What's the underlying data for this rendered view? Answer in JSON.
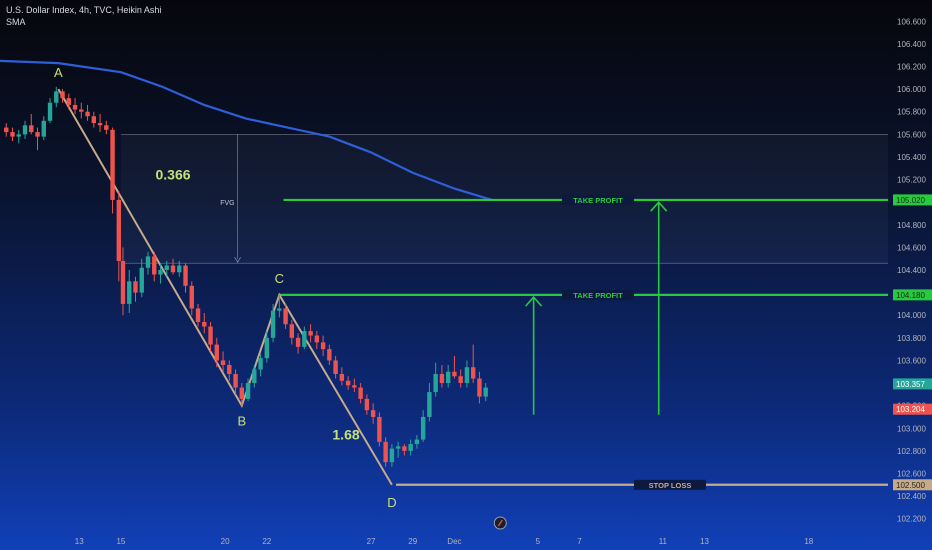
{
  "header": {
    "symbol_line": "U.S. Dollar Index, 4h, TVC, Heikin Ashi",
    "indicator": "SMA"
  },
  "colors": {
    "bull": "#26a69a",
    "bear": "#ef5350",
    "sma": "#2f5fd8",
    "pattern": "#c8a98a",
    "target": "#27c93f",
    "label": "#c6e07a",
    "axis_text": "#b2b5be"
  },
  "chart_data": {
    "type": "candlestick",
    "chart_style": "Heikin Ashi",
    "timeframe": "4h",
    "ylim": [
      102.1,
      106.7
    ],
    "y_ticks": [
      102.2,
      102.4,
      102.6,
      102.8,
      103.0,
      103.2,
      103.4,
      103.6,
      103.8,
      104.0,
      104.2,
      104.4,
      104.6,
      104.8,
      105.0,
      105.2,
      105.4,
      105.6,
      105.8,
      106.0,
      106.2,
      106.4,
      106.6
    ],
    "y_tick_labels": [
      "102.200",
      "102.400",
      "102.600",
      "102.800",
      "103.000",
      "103.200",
      "103.400",
      "103.600",
      "103.800",
      "104.000",
      "104.200",
      "104.400",
      "104.600",
      "104.800",
      "105.000",
      "105.200",
      "105.400",
      "105.600",
      "105.800",
      "106.000",
      "106.200",
      "106.400",
      "106.600"
    ],
    "x_ticks": [
      {
        "label": "13",
        "day": 13
      },
      {
        "label": "15",
        "day": 15
      },
      {
        "label": "20",
        "day": 20
      },
      {
        "label": "22",
        "day": 22
      },
      {
        "label": "27",
        "day": 27
      },
      {
        "label": "29",
        "day": 29
      },
      {
        "label": "Dec",
        "day": 31
      },
      {
        "label": "5",
        "day": 35
      },
      {
        "label": "7",
        "day": 37
      },
      {
        "label": "11",
        "day": 41
      },
      {
        "label": "13",
        "day": 43
      },
      {
        "label": "18",
        "day": 48
      }
    ],
    "x_range_days": [
      9.2,
      51.8
    ],
    "candles": [
      {
        "day": 9.5,
        "o": 105.66,
        "h": 105.7,
        "l": 105.58,
        "c": 105.62
      },
      {
        "day": 9.8,
        "o": 105.62,
        "h": 105.66,
        "l": 105.54,
        "c": 105.58
      },
      {
        "day": 10.1,
        "o": 105.58,
        "h": 105.64,
        "l": 105.52,
        "c": 105.6
      },
      {
        "day": 10.4,
        "o": 105.6,
        "h": 105.72,
        "l": 105.56,
        "c": 105.68
      },
      {
        "day": 10.7,
        "o": 105.68,
        "h": 105.78,
        "l": 105.6,
        "c": 105.62
      },
      {
        "day": 11.0,
        "o": 105.62,
        "h": 105.66,
        "l": 105.46,
        "c": 105.58
      },
      {
        "day": 11.3,
        "o": 105.58,
        "h": 105.76,
        "l": 105.55,
        "c": 105.72
      },
      {
        "day": 11.6,
        "o": 105.72,
        "h": 105.92,
        "l": 105.7,
        "c": 105.88
      },
      {
        "day": 11.9,
        "o": 105.88,
        "h": 106.02,
        "l": 105.84,
        "c": 105.98
      },
      {
        "day": 12.2,
        "o": 105.98,
        "h": 106.0,
        "l": 105.88,
        "c": 105.92
      },
      {
        "day": 12.5,
        "o": 105.92,
        "h": 105.96,
        "l": 105.82,
        "c": 105.86
      },
      {
        "day": 12.8,
        "o": 105.86,
        "h": 105.92,
        "l": 105.78,
        "c": 105.82
      },
      {
        "day": 13.1,
        "o": 105.82,
        "h": 105.88,
        "l": 105.74,
        "c": 105.8
      },
      {
        "day": 13.4,
        "o": 105.8,
        "h": 105.86,
        "l": 105.72,
        "c": 105.76
      },
      {
        "day": 13.7,
        "o": 105.76,
        "h": 105.8,
        "l": 105.66,
        "c": 105.7
      },
      {
        "day": 14.0,
        "o": 105.7,
        "h": 105.78,
        "l": 105.62,
        "c": 105.68
      },
      {
        "day": 14.3,
        "o": 105.68,
        "h": 105.72,
        "l": 105.6,
        "c": 105.64
      },
      {
        "day": 14.6,
        "o": 105.64,
        "h": 105.66,
        "l": 104.9,
        "c": 105.02
      },
      {
        "day": 14.9,
        "o": 105.02,
        "h": 105.1,
        "l": 104.3,
        "c": 104.48
      },
      {
        "day": 15.1,
        "o": 104.48,
        "h": 104.6,
        "l": 104.0,
        "c": 104.1
      },
      {
        "day": 15.4,
        "o": 104.1,
        "h": 104.4,
        "l": 104.02,
        "c": 104.3
      },
      {
        "day": 15.7,
        "o": 104.3,
        "h": 104.34,
        "l": 104.12,
        "c": 104.2
      },
      {
        "day": 16.0,
        "o": 104.2,
        "h": 104.5,
        "l": 104.16,
        "c": 104.42
      },
      {
        "day": 16.3,
        "o": 104.42,
        "h": 104.56,
        "l": 104.36,
        "c": 104.52
      },
      {
        "day": 16.6,
        "o": 104.52,
        "h": 104.56,
        "l": 104.3,
        "c": 104.36
      },
      {
        "day": 16.9,
        "o": 104.36,
        "h": 104.46,
        "l": 104.28,
        "c": 104.4
      },
      {
        "day": 17.2,
        "o": 104.4,
        "h": 104.48,
        "l": 104.34,
        "c": 104.44
      },
      {
        "day": 17.5,
        "o": 104.44,
        "h": 104.5,
        "l": 104.36,
        "c": 104.38
      },
      {
        "day": 17.8,
        "o": 104.38,
        "h": 104.48,
        "l": 104.34,
        "c": 104.44
      },
      {
        "day": 18.1,
        "o": 104.44,
        "h": 104.46,
        "l": 104.2,
        "c": 104.26
      },
      {
        "day": 18.4,
        "o": 104.26,
        "h": 104.3,
        "l": 104.0,
        "c": 104.06
      },
      {
        "day": 18.7,
        "o": 104.06,
        "h": 104.1,
        "l": 103.9,
        "c": 103.94
      },
      {
        "day": 19.0,
        "o": 103.94,
        "h": 104.02,
        "l": 103.84,
        "c": 103.9
      },
      {
        "day": 19.3,
        "o": 103.9,
        "h": 103.94,
        "l": 103.68,
        "c": 103.74
      },
      {
        "day": 19.6,
        "o": 103.74,
        "h": 103.8,
        "l": 103.54,
        "c": 103.6
      },
      {
        "day": 19.9,
        "o": 103.6,
        "h": 103.68,
        "l": 103.5,
        "c": 103.56
      },
      {
        "day": 20.2,
        "o": 103.56,
        "h": 103.6,
        "l": 103.42,
        "c": 103.48
      },
      {
        "day": 20.5,
        "o": 103.48,
        "h": 103.52,
        "l": 103.3,
        "c": 103.36
      },
      {
        "day": 20.8,
        "o": 103.36,
        "h": 103.4,
        "l": 103.2,
        "c": 103.26
      },
      {
        "day": 21.1,
        "o": 103.26,
        "h": 103.44,
        "l": 103.24,
        "c": 103.4
      },
      {
        "day": 21.4,
        "o": 103.4,
        "h": 103.56,
        "l": 103.36,
        "c": 103.52
      },
      {
        "day": 21.7,
        "o": 103.52,
        "h": 103.66,
        "l": 103.46,
        "c": 103.62
      },
      {
        "day": 22.0,
        "o": 103.62,
        "h": 103.86,
        "l": 103.58,
        "c": 103.8
      },
      {
        "day": 22.3,
        "o": 103.8,
        "h": 104.1,
        "l": 103.76,
        "c": 104.04
      },
      {
        "day": 22.6,
        "o": 104.04,
        "h": 104.18,
        "l": 103.98,
        "c": 104.06
      },
      {
        "day": 22.9,
        "o": 104.06,
        "h": 104.1,
        "l": 103.88,
        "c": 103.92
      },
      {
        "day": 23.2,
        "o": 103.92,
        "h": 103.96,
        "l": 103.74,
        "c": 103.8
      },
      {
        "day": 23.5,
        "o": 103.8,
        "h": 103.84,
        "l": 103.66,
        "c": 103.72
      },
      {
        "day": 23.8,
        "o": 103.72,
        "h": 103.9,
        "l": 103.7,
        "c": 103.86
      },
      {
        "day": 24.1,
        "o": 103.86,
        "h": 103.92,
        "l": 103.76,
        "c": 103.82
      },
      {
        "day": 24.4,
        "o": 103.82,
        "h": 103.86,
        "l": 103.7,
        "c": 103.76
      },
      {
        "day": 24.7,
        "o": 103.76,
        "h": 103.82,
        "l": 103.64,
        "c": 103.7
      },
      {
        "day": 25.0,
        "o": 103.7,
        "h": 103.74,
        "l": 103.56,
        "c": 103.6
      },
      {
        "day": 25.3,
        "o": 103.6,
        "h": 103.64,
        "l": 103.44,
        "c": 103.48
      },
      {
        "day": 25.6,
        "o": 103.48,
        "h": 103.54,
        "l": 103.38,
        "c": 103.42
      },
      {
        "day": 25.9,
        "o": 103.42,
        "h": 103.46,
        "l": 103.34,
        "c": 103.38
      },
      {
        "day": 26.2,
        "o": 103.38,
        "h": 103.44,
        "l": 103.32,
        "c": 103.36
      },
      {
        "day": 26.5,
        "o": 103.36,
        "h": 103.4,
        "l": 103.22,
        "c": 103.26
      },
      {
        "day": 26.8,
        "o": 103.26,
        "h": 103.3,
        "l": 103.12,
        "c": 103.16
      },
      {
        "day": 27.1,
        "o": 103.16,
        "h": 103.22,
        "l": 103.04,
        "c": 103.1
      },
      {
        "day": 27.4,
        "o": 103.1,
        "h": 103.14,
        "l": 102.84,
        "c": 102.88
      },
      {
        "day": 27.7,
        "o": 102.88,
        "h": 102.92,
        "l": 102.66,
        "c": 102.7
      },
      {
        "day": 28.0,
        "o": 102.7,
        "h": 102.86,
        "l": 102.66,
        "c": 102.82
      },
      {
        "day": 28.3,
        "o": 102.82,
        "h": 102.88,
        "l": 102.74,
        "c": 102.84
      },
      {
        "day": 28.6,
        "o": 102.84,
        "h": 102.86,
        "l": 102.76,
        "c": 102.8
      },
      {
        "day": 28.9,
        "o": 102.8,
        "h": 102.9,
        "l": 102.76,
        "c": 102.86
      },
      {
        "day": 29.2,
        "o": 102.86,
        "h": 102.94,
        "l": 102.82,
        "c": 102.9
      },
      {
        "day": 29.5,
        "o": 102.9,
        "h": 103.16,
        "l": 102.88,
        "c": 103.1
      },
      {
        "day": 29.8,
        "o": 103.1,
        "h": 103.4,
        "l": 103.06,
        "c": 103.32
      },
      {
        "day": 30.1,
        "o": 103.32,
        "h": 103.58,
        "l": 103.28,
        "c": 103.48
      },
      {
        "day": 30.4,
        "o": 103.48,
        "h": 103.56,
        "l": 103.36,
        "c": 103.4
      },
      {
        "day": 30.7,
        "o": 103.4,
        "h": 103.56,
        "l": 103.36,
        "c": 103.5
      },
      {
        "day": 31.0,
        "o": 103.5,
        "h": 103.64,
        "l": 103.44,
        "c": 103.46
      },
      {
        "day": 31.3,
        "o": 103.46,
        "h": 103.52,
        "l": 103.36,
        "c": 103.4
      },
      {
        "day": 31.6,
        "o": 103.4,
        "h": 103.6,
        "l": 103.36,
        "c": 103.54
      },
      {
        "day": 31.9,
        "o": 103.54,
        "h": 103.74,
        "l": 103.4,
        "c": 103.44
      },
      {
        "day": 32.2,
        "o": 103.44,
        "h": 103.5,
        "l": 103.22,
        "c": 103.28
      },
      {
        "day": 32.5,
        "o": 103.28,
        "h": 103.4,
        "l": 103.24,
        "c": 103.36
      }
    ],
    "sma_line": [
      {
        "day": 9.2,
        "v": 106.25
      },
      {
        "day": 12.0,
        "v": 106.23
      },
      {
        "day": 15.0,
        "v": 106.15
      },
      {
        "day": 17.0,
        "v": 106.02
      },
      {
        "day": 19.0,
        "v": 105.86
      },
      {
        "day": 21.0,
        "v": 105.74
      },
      {
        "day": 23.0,
        "v": 105.66
      },
      {
        "day": 25.0,
        "v": 105.58
      },
      {
        "day": 27.0,
        "v": 105.44
      },
      {
        "day": 29.0,
        "v": 105.26
      },
      {
        "day": 31.0,
        "v": 105.12
      },
      {
        "day": 32.8,
        "v": 105.02
      }
    ],
    "pattern": [
      {
        "label": "A",
        "day": 12.0,
        "v": 106.0
      },
      {
        "label": "B",
        "day": 20.8,
        "v": 103.2
      },
      {
        "label": "C",
        "day": 22.6,
        "v": 104.18
      },
      {
        "label": "D",
        "day": 28.0,
        "v": 102.5
      }
    ],
    "fvg": {
      "label": "FVG",
      "top": 105.6,
      "bottom": 104.46,
      "from_day": 15.0
    },
    "ratios": [
      {
        "text": "0.366",
        "day": 17.5,
        "v": 105.2
      },
      {
        "text": "1.68",
        "day": 25.8,
        "v": 102.9
      }
    ],
    "take_profit_1": {
      "label": "TAKE PROFIT",
      "value": 105.02,
      "from_day": 22.8,
      "axis_text": "105.020"
    },
    "take_profit_2": {
      "label": "TAKE PROFIT",
      "value": 104.18,
      "from_day": 22.6,
      "axis_text": "104.180"
    },
    "stop_loss": {
      "label": "STOP LOSS",
      "value": 102.5,
      "from_day": 28.2,
      "axis_text": "102.500"
    },
    "arrows": [
      {
        "day": 34.8,
        "from": 103.12,
        "to": 104.16
      },
      {
        "day": 40.8,
        "from": 103.12,
        "to": 105.0
      }
    ],
    "price_badges": [
      {
        "text": "103.357",
        "value": 103.357,
        "color": "#26a69a"
      },
      {
        "text": "103.204",
        "value": 103.204,
        "color": "#ef5350"
      }
    ],
    "partial_tick": "103.400"
  }
}
